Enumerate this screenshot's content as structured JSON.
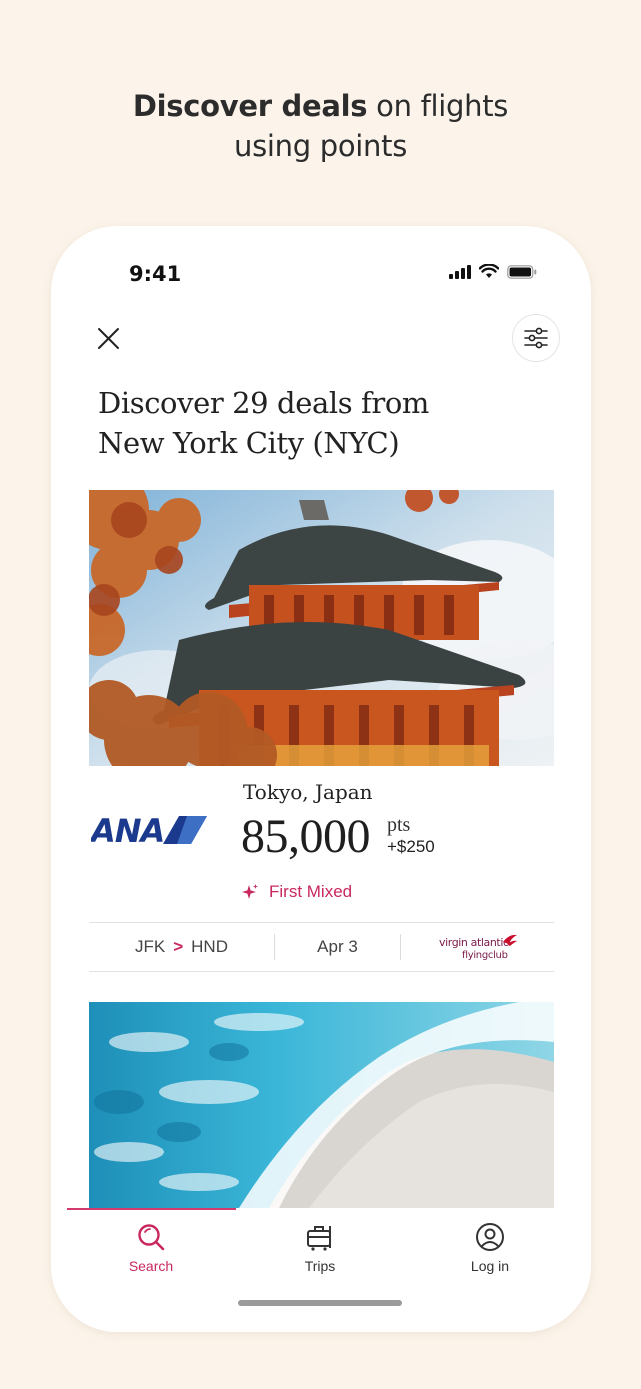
{
  "promo": {
    "headline_bold": "Discover deals",
    "headline_rest": " on flights",
    "headline_line2": "using points"
  },
  "status_bar": {
    "time": "9:41"
  },
  "header": {
    "close_icon": "close-icon",
    "filter_icon": "sliders-icon",
    "title_line1": "Discover 29 deals from",
    "title_line2": "New York City (NYC)"
  },
  "deals": [
    {
      "image": "pagoda-photo",
      "airline": "ANA",
      "destination": "Tokyo, Japan",
      "points": "85,000",
      "points_unit": "pts",
      "fee": "+$250",
      "cabin": "First Mixed",
      "origin": "JFK",
      "arrow": ">",
      "dest_code": "HND",
      "date": "Apr 3",
      "partner_line1": "virgin atlantic",
      "partner_line2": "flyingclub"
    },
    {
      "image": "ocean-beach-photo"
    }
  ],
  "tabs": [
    {
      "label": "Search",
      "icon": "search-icon",
      "active": true
    },
    {
      "label": "Trips",
      "icon": "luggage-icon",
      "active": false
    },
    {
      "label": "Log in",
      "icon": "user-icon",
      "active": false
    }
  ],
  "colors": {
    "accent": "#c8285f",
    "ana_blue": "#1b3a8e",
    "background": "#fcf4ea"
  }
}
